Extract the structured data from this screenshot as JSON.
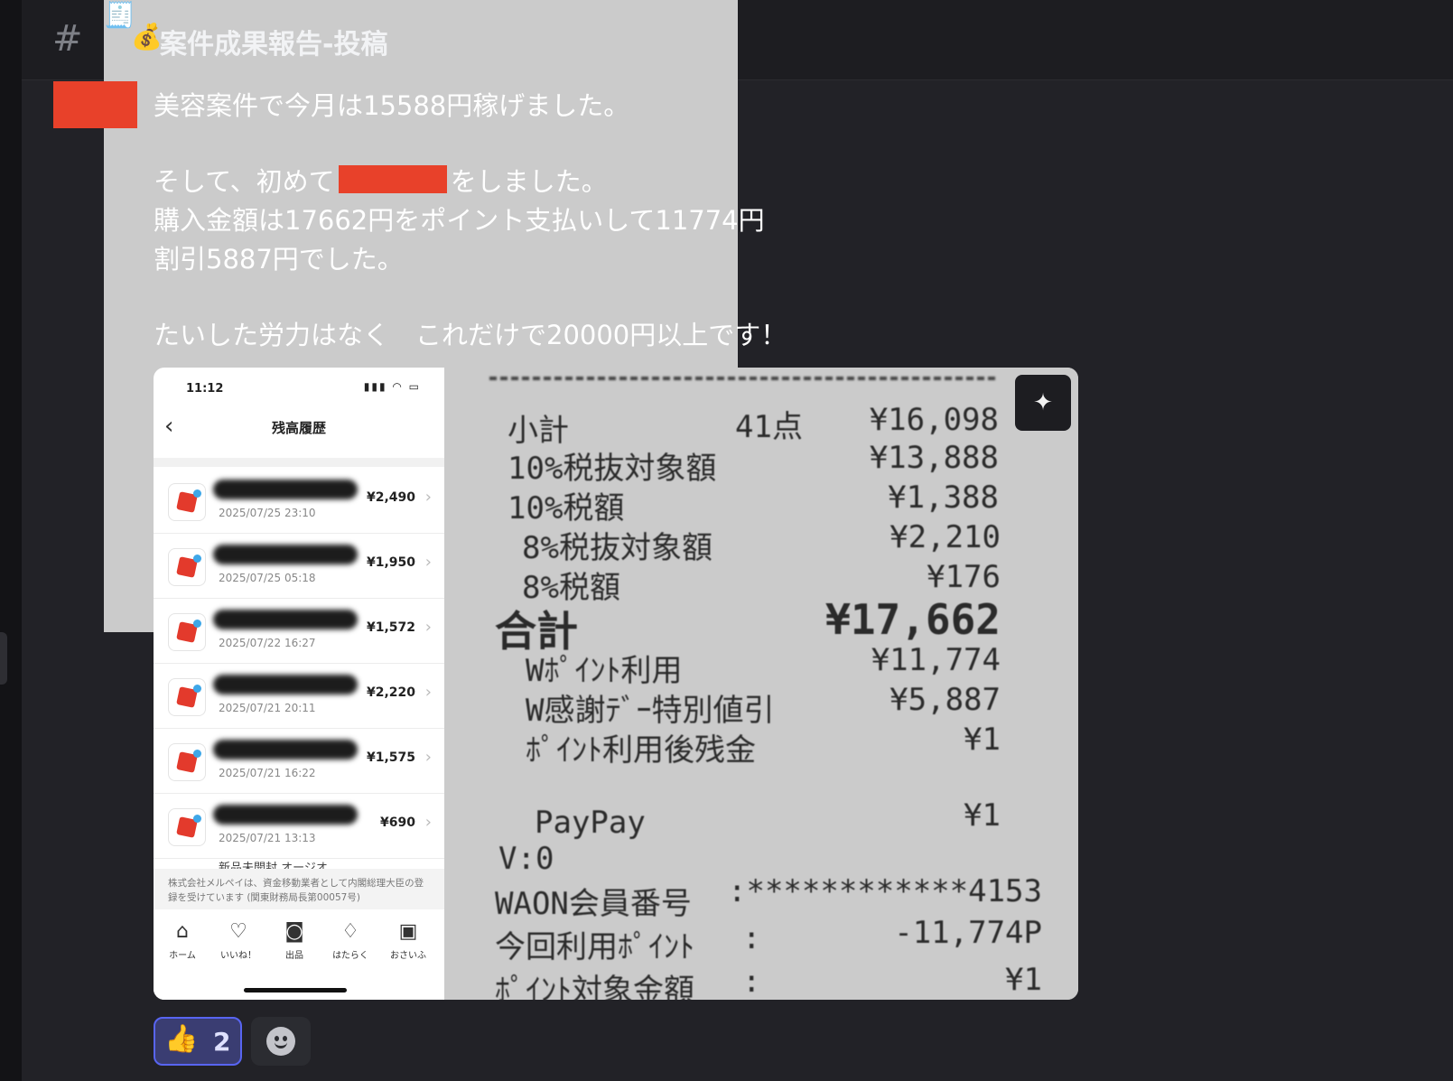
{
  "channel": {
    "hash": "#",
    "receipt_emoji": "🧾",
    "money_emoji": "💰",
    "title": "案件成果報告-投稿"
  },
  "message": {
    "line1": "美容案件で今月は15588円稼げました。",
    "line2_before": "そして、初めて",
    "line2_after": "をしました。",
    "line3": "購入金額は17662円をポイント支払いして11774円",
    "line4": "割引5887円でした。",
    "line5": "たいした労力はなく　これだけで20000円以上です！"
  },
  "phone": {
    "time": "11:12",
    "status_icons": "▮▮▮ ◠ ▭",
    "back": "‹",
    "title": "残高履歴",
    "transactions": [
      {
        "date": "2025/07/25 23:10",
        "amount": "¥2,490"
      },
      {
        "date": "2025/07/25 05:18",
        "amount": "¥1,950"
      },
      {
        "date": "2025/07/22 16:27",
        "amount": "¥1,572"
      },
      {
        "date": "2025/07/21 20:11",
        "amount": "¥2,220"
      },
      {
        "date": "2025/07/21 16:22",
        "amount": "¥1,575"
      },
      {
        "date": "2025/07/21 13:13",
        "amount": "¥690"
      }
    ],
    "partial_item": "新品未開封 オージオ…",
    "footer_note": "株式会社メルペイは、資金移動業者として内閣総理大臣の登録を受けています (関東財務局長第00057号)",
    "tabs": [
      {
        "icon": "⌂",
        "label": "ホーム"
      },
      {
        "icon": "♡",
        "label": "いいね！"
      },
      {
        "icon": "◙",
        "label": "出品"
      },
      {
        "icon": "♢",
        "label": "はたらく"
      },
      {
        "icon": "▣",
        "label": "おさいふ"
      }
    ]
  },
  "receipt": {
    "subtotal_label": "小計",
    "subtotal_count": "41点",
    "subtotal_value": "¥16,098",
    "tax10_base_label": "10%税抜対象額",
    "tax10_base_value": "¥13,888",
    "tax10_label": "10%税額",
    "tax10_value": "¥1,388",
    "tax8_base_label": "8%税抜対象額",
    "tax8_base_value": "¥2,210",
    "tax8_label": "8%税額",
    "tax8_value": "¥176",
    "total_label": "合計",
    "total_value": "¥17,662",
    "points_used_label": "Wﾎﾟｲﾝﾄ利用",
    "points_used_value": "¥11,774",
    "discount_label": "W感謝ﾃﾞｰ特別値引",
    "discount_value": "¥5,887",
    "balance_label": "ﾎﾟｲﾝﾄ利用後残金",
    "balance_value": "¥1",
    "paypay_label": "PayPay",
    "paypay_value": "¥1",
    "v_line": "V:0",
    "waon_label": "WAON会員番号",
    "waon_value": ":************4153",
    "this_points_label": "今回利用ﾎﾟｲﾝﾄ",
    "this_points_colon": ":",
    "this_points_value": "-11,774P",
    "partial_label": "ﾎﾟｲﾝﾄ対象金額",
    "partial_colon": ":",
    "partial_value": "¥1"
  },
  "reaction": {
    "emoji": "👍",
    "count": "2"
  },
  "colors": {
    "redaction": "#e8412a",
    "reaction_border": "#5865f2",
    "background": "#222227"
  }
}
